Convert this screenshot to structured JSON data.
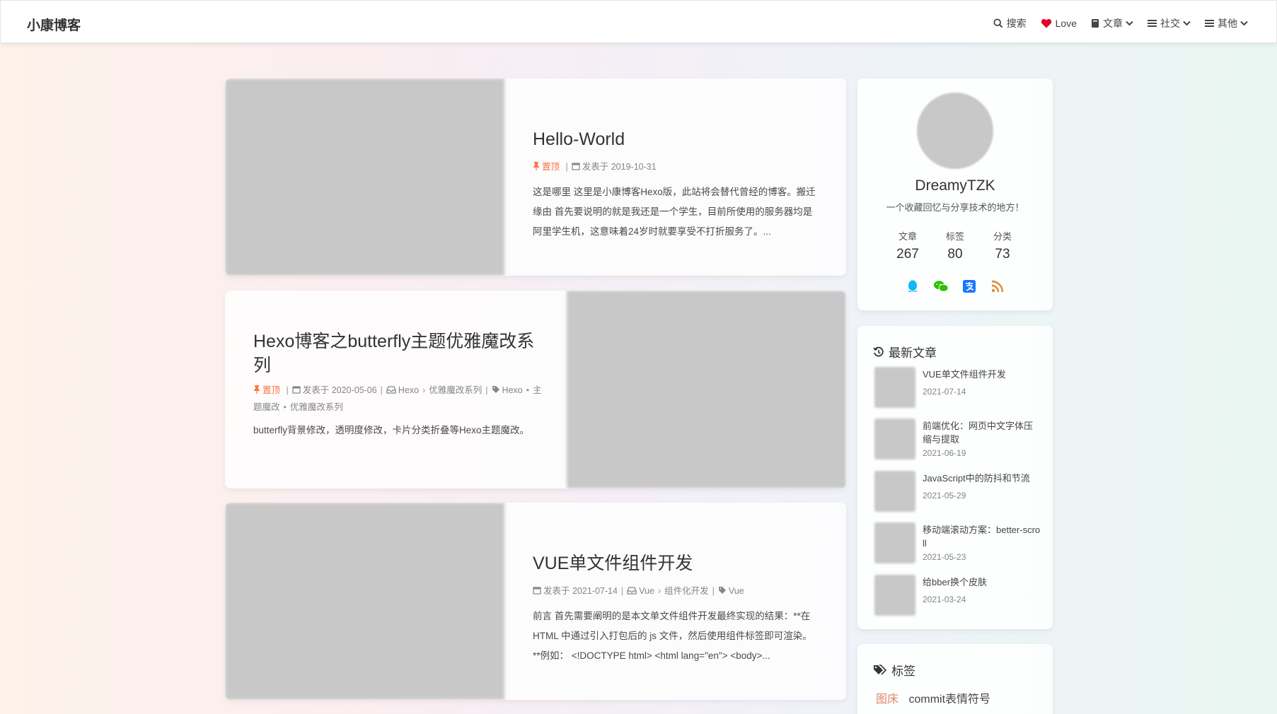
{
  "site": {
    "name": "小康博客"
  },
  "nav": {
    "search": "搜索",
    "love": "Love",
    "articles": "文章",
    "social": "社交",
    "other": "其他"
  },
  "posts": [
    {
      "title": "Hello-World",
      "sticky": "置顶",
      "date": "发表于 2019-10-31",
      "excerpt": "这是哪里 这里是小康博客Hexo版，此站将会替代曾经的博客。搬迁缘由 首先要说明的就是我还是一个学生，目前所使用的服务器均是阿里学生机，这意味着24岁时就要享受不打折服务了。..."
    },
    {
      "title": "Hexo博客之butterfly主题优雅魔改系列",
      "sticky": "置顶",
      "date": "发表于 2020-05-06",
      "categories": [
        "Hexo",
        "优雅魔改系列"
      ],
      "tags": [
        "Hexo",
        "主题魔改",
        "优雅魔改系列"
      ],
      "excerpt": "butterfly背景修改，透明度修改，卡片分类折叠等Hexo主题魔改。"
    },
    {
      "title": "VUE单文件组件开发",
      "date": "发表于 2021-07-14",
      "categories": [
        "Vue",
        "组件化开发"
      ],
      "tags": [
        "Vue"
      ],
      "excerpt": "前言 首先需要阐明的是本文单文件组件开发最终实现的结果：**在 HTML 中通过引入打包后的 js 文件，然后使用组件标签即可渲染。**例如： <!DOCTYPE html> <html lang=\"en\"> <body>..."
    }
  ],
  "author": {
    "name": "DreamyTZK",
    "description": "一个收藏回忆与分享技术的地方！",
    "stats": [
      {
        "label": "文章",
        "value": "267"
      },
      {
        "label": "标签",
        "value": "80"
      },
      {
        "label": "分类",
        "value": "73"
      }
    ],
    "social_icons": [
      "qq-icon",
      "wechat-icon",
      "alipay-icon",
      "rss-icon"
    ]
  },
  "recent": {
    "heading": "最新文章",
    "items": [
      {
        "title": "VUE单文件组件开发",
        "date": "2021-07-14"
      },
      {
        "title": "前端优化：网页中文字体压缩与提取",
        "date": "2021-06-19"
      },
      {
        "title": "JavaScript中的防抖和节流",
        "date": "2021-05-29"
      },
      {
        "title": "移动端滚动方案：better-scroll",
        "date": "2021-05-23"
      },
      {
        "title": "给bber换个皮肤",
        "date": "2021-03-24"
      }
    ]
  },
  "tags_card": {
    "heading": "标签",
    "tags": [
      "图床",
      "commit表情符号"
    ]
  },
  "colors": {
    "sticky": "#ff7242",
    "accent": "#49b1f5",
    "love": "#e3002b"
  }
}
